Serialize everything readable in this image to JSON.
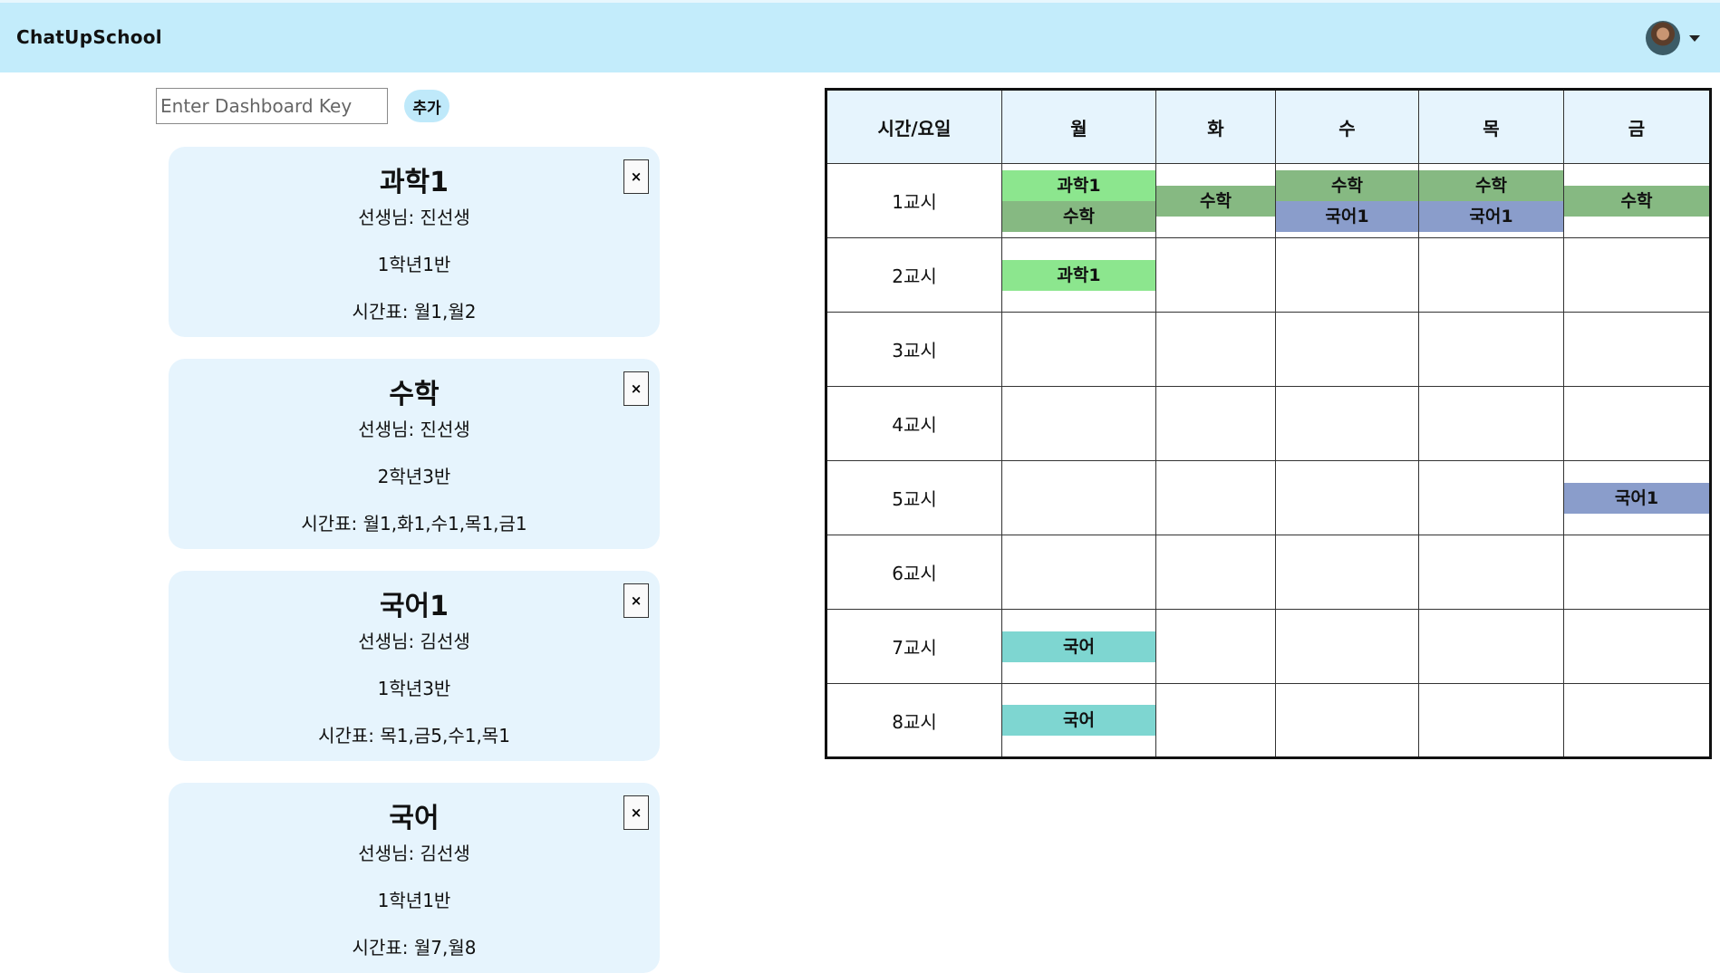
{
  "app": {
    "title": "ChatUpSchool"
  },
  "dashboard": {
    "key_placeholder": "Enter Dashboard Key",
    "add_label": "추가"
  },
  "courses": [
    {
      "title": "과학1",
      "teacher": "선생님: 진선생",
      "class_name": "1학년1반",
      "schedule": "시간표: 월1,월2",
      "close_label": "×"
    },
    {
      "title": "수학",
      "teacher": "선생님: 진선생",
      "class_name": "2학년3반",
      "schedule": "시간표: 월1,화1,수1,목1,금1",
      "close_label": "×"
    },
    {
      "title": "국어1",
      "teacher": "선생님: 김선생",
      "class_name": "1학년3반",
      "schedule": "시간표: 목1,금5,수1,목1",
      "close_label": "×"
    },
    {
      "title": "국어",
      "teacher": "선생님: 김선생",
      "class_name": "1학년1반",
      "schedule": "시간표: 월7,월8",
      "close_label": "×"
    }
  ],
  "timetable": {
    "corner": "시간/요일",
    "days": [
      "월",
      "화",
      "수",
      "목",
      "금"
    ],
    "periods": [
      "1교시",
      "2교시",
      "3교시",
      "4교시",
      "5교시",
      "6교시",
      "7교시",
      "8교시"
    ],
    "colors": {
      "과학1": "#8ce68e",
      "수학": "#86b982",
      "국어1": "#8a9dcb",
      "국어": "#7ed6d1"
    },
    "entries": [
      [
        [
          "과학1",
          "수학"
        ],
        [
          "수학"
        ],
        [
          "수학",
          "국어1"
        ],
        [
          "수학",
          "국어1"
        ],
        [
          "수학"
        ]
      ],
      [
        [
          "과학1"
        ],
        [],
        [],
        [],
        []
      ],
      [
        [],
        [],
        [],
        [],
        []
      ],
      [
        [],
        [],
        [],
        [],
        []
      ],
      [
        [],
        [],
        [],
        [],
        [
          "국어1"
        ]
      ],
      [
        [],
        [],
        [],
        [],
        []
      ],
      [
        [
          "국어"
        ],
        [],
        [],
        [],
        []
      ],
      [
        [
          "국어"
        ],
        [],
        [],
        [],
        []
      ]
    ]
  }
}
